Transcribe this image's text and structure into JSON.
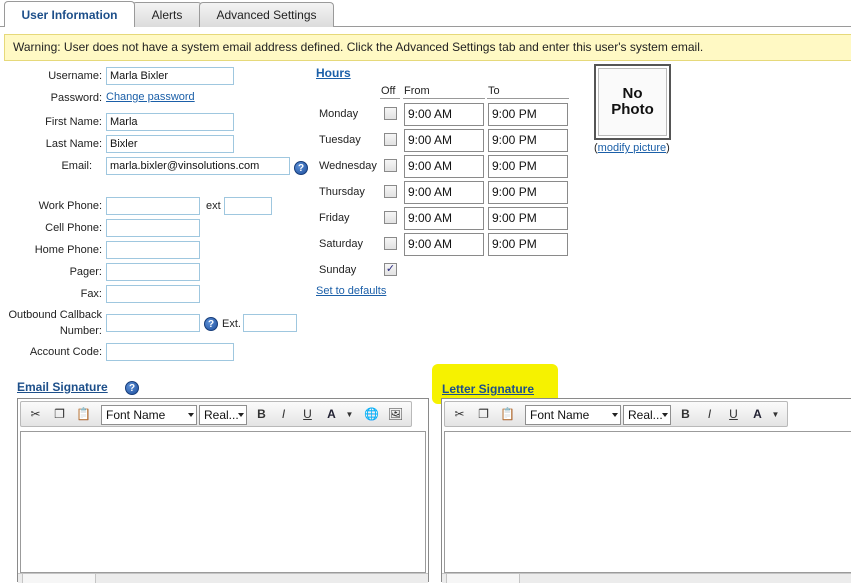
{
  "tabs": [
    {
      "label": "User Information",
      "active": true
    },
    {
      "label": "Alerts",
      "active": false
    },
    {
      "label": "Advanced Settings",
      "active": false
    }
  ],
  "warning": "Warning: User does not have a system email address defined. Click the Advanced Settings tab and enter this user's system email.",
  "user": {
    "username_label": "Username:",
    "username": "Marla Bixler",
    "password_label": "Password:",
    "change_password": "Change password",
    "first_name_label": "First Name:",
    "first_name": "Marla",
    "last_name_label": "Last Name:",
    "last_name": "Bixler",
    "email_label": "Email:",
    "email": "marla.bixler@vinsolutions.com",
    "work_phone_label": "Work Phone:",
    "work_phone": "",
    "ext_label": "ext",
    "ext": "",
    "cell_phone_label": "Cell Phone:",
    "cell_phone": "",
    "home_phone_label": "Home Phone:",
    "home_phone": "",
    "pager_label": "Pager:",
    "pager": "",
    "fax_label": "Fax:",
    "fax": "",
    "callback_label_1": "Outbound Callback",
    "callback_label_2": "Number:",
    "callback": "",
    "callback_ext_label": "Ext.",
    "callback_ext": "",
    "account_code_label": "Account Code:",
    "account_code": ""
  },
  "hours": {
    "title": "Hours",
    "col_off": "Off",
    "col_from": "From",
    "col_to": "To",
    "days": [
      {
        "name": "Monday",
        "off": false,
        "from": "9:00 AM",
        "to": "9:00 PM"
      },
      {
        "name": "Tuesday",
        "off": false,
        "from": "9:00 AM",
        "to": "9:00 PM"
      },
      {
        "name": "Wednesday",
        "off": false,
        "from": "9:00 AM",
        "to": "9:00 PM"
      },
      {
        "name": "Thursday",
        "off": false,
        "from": "9:00 AM",
        "to": "9:00 PM"
      },
      {
        "name": "Friday",
        "off": false,
        "from": "9:00 AM",
        "to": "9:00 PM"
      },
      {
        "name": "Saturday",
        "off": false,
        "from": "9:00 AM",
        "to": "9:00 PM"
      },
      {
        "name": "Sunday",
        "off": true,
        "from": "",
        "to": ""
      }
    ],
    "set_defaults": "Set to defaults"
  },
  "photo": {
    "line1": "No",
    "line2": "Photo",
    "open_paren": "(",
    "modify": "modify picture",
    "close_paren": ")"
  },
  "email_signature": {
    "title": "Email Signature",
    "font_name": "Font Name",
    "font_size": "Real...",
    "bold": "B",
    "italic": "I",
    "underline": "U",
    "color": "A"
  },
  "letter_signature": {
    "title": "Letter Signature",
    "highlight_color": "#f6f200",
    "font_name": "Font Name",
    "font_size": "Real...",
    "bold": "B",
    "italic": "I",
    "underline": "U",
    "color": "A"
  },
  "colors": {
    "link": "#1b5fa8",
    "input_border": "#9fc7df",
    "warning_bg": "#fff9c4"
  }
}
